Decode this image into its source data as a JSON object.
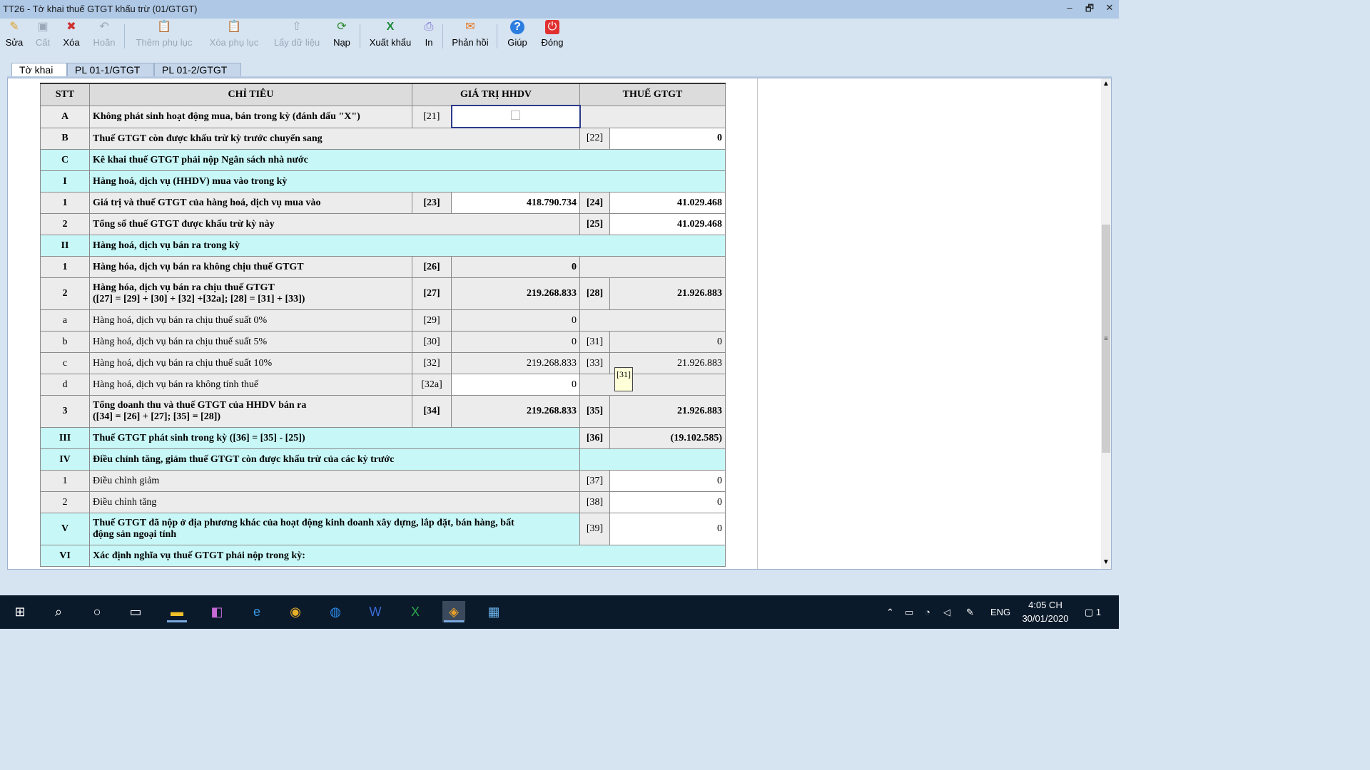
{
  "window": {
    "title": "TT26 - Tờ khai thuế GTGT khấu trừ (01/GTGT)",
    "controls": [
      "–",
      "🗗",
      "✕"
    ]
  },
  "toolbar": {
    "sua": "Sửa",
    "cat": "Cất",
    "xoa": "Xóa",
    "hoan": "Hoãn",
    "them_phu_luc": "Thêm phụ lục",
    "xoa_phu_luc": "Xóa phụ lục",
    "lay_du_lieu": "Lấy dữ liệu",
    "nap": "Nạp",
    "xuat_khau": "Xuất khẩu",
    "in": "In",
    "phan_hoi": "Phản hồi",
    "giup": "Giúp",
    "dong": "Đóng"
  },
  "tabs": [
    "Tờ khai",
    "PL 01-1/GTGT",
    "PL 01-2/GTGT"
  ],
  "table": {
    "headers": {
      "stt": "STT",
      "chi_tieu": "CHỈ TIÊU",
      "gia_tri": "GIÁ TRỊ HHDV",
      "thue": "THUẾ GTGT"
    },
    "rows": {
      "A": {
        "stt": "A",
        "label": "Không phát sinh hoạt động mua, bán trong kỳ (đánh dấu \"X\")",
        "code": "[21]"
      },
      "B": {
        "stt": "B",
        "label": "Thuế GTGT còn được khấu trừ kỳ trước chuyển sang",
        "code": "[22]",
        "value": "0"
      },
      "C": {
        "stt": "C",
        "label": "Kê khai thuế GTGT phải nộp Ngân sách nhà nước"
      },
      "I": {
        "stt": "I",
        "label": "Hàng hoá, dịch vụ (HHDV) mua vào trong kỳ"
      },
      "I1": {
        "stt": "1",
        "label": "Giá trị và thuế GTGT của hàng hoá, dịch vụ mua vào",
        "code1": "[23]",
        "value1": "418.790.734",
        "code2": "[24]",
        "value2": "41.029.468"
      },
      "I2": {
        "stt": "2",
        "label": "Tổng số thuế GTGT  được khấu trừ kỳ này",
        "code": "[25]",
        "value": "41.029.468"
      },
      "II": {
        "stt": "II",
        "label": "Hàng hoá, dịch vụ bán ra trong kỳ"
      },
      "II1": {
        "stt": "1",
        "label": "Hàng hóa, dịch vụ bán ra không chịu thuế GTGT",
        "code": "[26]",
        "value": "0"
      },
      "II2": {
        "stt": "2",
        "label1": "Hàng hóa, dịch vụ bán ra chịu thuế GTGT",
        "label2": "([27] = [29] + [30] + [32] +[32a]; [28] = [31] + [33])",
        "code1": "[27]",
        "value1": "219.268.833",
        "code2": "[28]",
        "value2": "21.926.883"
      },
      "a": {
        "stt": "a",
        "label": "Hàng hoá, dịch vụ bán ra chịu thuế suất 0%",
        "code": "[29]",
        "value": "0"
      },
      "b": {
        "stt": "b",
        "label": "Hàng hoá, dịch vụ bán ra chịu thuế suất 5%",
        "code1": "[30]",
        "value1": "0",
        "code2": "[31]",
        "value2": "0"
      },
      "c": {
        "stt": "c",
        "label": "Hàng hoá, dịch vụ bán ra chịu thuế suất 10%",
        "code1": "[32]",
        "value1": "219.268.833",
        "code2": "[33]",
        "value2": "21.926.883"
      },
      "d": {
        "stt": "d",
        "label": "Hàng hoá, dịch vụ bán ra không tính thuế",
        "code": "[32a]",
        "value": "0"
      },
      "II3": {
        "stt": "3",
        "label1": "Tổng doanh thu và thuế GTGT của HHDV bán   ra",
        "label2": "([34] = [26] + [27]; [35] = [28])",
        "code1": "[34]",
        "value1": "219.268.833",
        "code2": "[35]",
        "value2": "21.926.883"
      },
      "III": {
        "stt": "III",
        "label": "Thuế GTGT phát sinh trong kỳ ([36] = [35] - [25])",
        "code": "[36]",
        "value": "(19.102.585)"
      },
      "IV": {
        "stt": "IV",
        "label": "Điều chỉnh tăng, giảm thuế GTGT còn được khấu trừ của các kỳ trước"
      },
      "IV1": {
        "stt": "1",
        "label": "Điều chỉnh giảm",
        "code": "[37]",
        "value": "0"
      },
      "IV2": {
        "stt": "2",
        "label": "Điều chỉnh tăng",
        "code": "[38]",
        "value": "0"
      },
      "V": {
        "stt": "V",
        "label1": "Thuế GTGT đã nộp ở địa phương khác của hoạt động kinh doanh xây dựng, lắp đặt, bán hàng, bất",
        "label2": "động sản ngoại tỉnh",
        "code": "[39]",
        "value": "0"
      },
      "VI": {
        "stt": "VI",
        "label": "Xác định nghĩa vụ thuế GTGT phải nộp trong kỳ:"
      }
    },
    "tooltip": "[31]"
  },
  "taskbar": {
    "lang": "ENG",
    "time": "4:05 CH",
    "date": "30/01/2020",
    "notif": "1"
  },
  "colors": {
    "cyan_row": "#c8f7f7",
    "grey_cell": "#ececec",
    "titlebar": "#aec8e6",
    "taskbar": "#0b1a2b"
  }
}
